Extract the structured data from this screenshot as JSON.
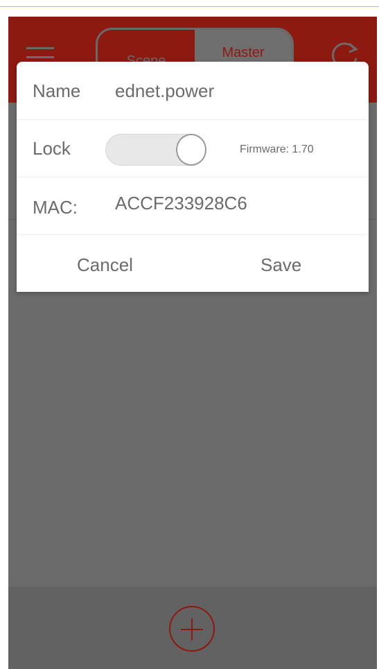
{
  "header": {
    "segments": [
      {
        "label": "Scene",
        "selected": false
      },
      {
        "label": "Master",
        "selected": true
      }
    ],
    "colors": {
      "brand": "#8c1a10",
      "dim_overlay": "#6b6b6b"
    }
  },
  "dialog": {
    "name_label": "Name",
    "name_value": "ednet.power",
    "lock_label": "Lock",
    "lock_on": true,
    "firmware_text": "Firmware: 1.70",
    "mac_label": "MAC:",
    "mac_value": "ACCF233928C6",
    "cancel_label": "Cancel",
    "save_label": "Save"
  },
  "footer": {
    "add_icon": "plus-circle-icon"
  }
}
